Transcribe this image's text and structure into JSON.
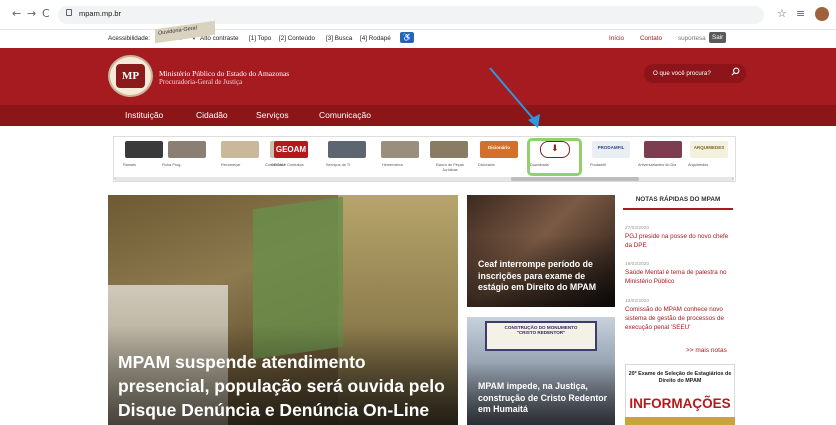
{
  "browser": {
    "back": "←",
    "forward": "→",
    "reload": "C",
    "url": "mpam.mp.br"
  },
  "accessibility_bar": {
    "label": "Acessibilidade:",
    "font_up": "A+",
    "font_normal": "A",
    "font_down": "A-",
    "contrast_symbol": "◖",
    "contrast": "Alto contraste",
    "top": "[1] Topo",
    "content": "[2] Conteúdo",
    "search": "[3] Busca",
    "footer": "[4] Rodapé",
    "badge": "♿",
    "home": "Início",
    "contact": "Contato",
    "support": "suportesa",
    "logout": "Sair"
  },
  "header": {
    "logo_text": "MP",
    "org_title": "Ministério Público do Estado do Amazonas",
    "org_subtitle": "Procuradoria-Geral de Justiça",
    "search_placeholder": "O que você procura?"
  },
  "nav": {
    "items": [
      "Instituição",
      "Cidadão",
      "Serviços",
      "Comunicação"
    ]
  },
  "shortcuts": [
    {
      "label": "Ramais",
      "color": "#3a3a3a"
    },
    {
      "label": "Ficha Prog.",
      "color": "#8a7f72"
    },
    {
      "label": "Recomeçar",
      "color": "#c9b99a"
    },
    {
      "label": "Convênios e Contratos",
      "color": "#c9c2b0",
      "tile_text": "Convênios"
    },
    {
      "label": "GEOAM",
      "color": "#b3191d",
      "tile_text": "GEOAM"
    },
    {
      "label": "Serviços de TI",
      "color": "#5d6670"
    },
    {
      "label": "Hemeroteca",
      "color": "#9a8f7c"
    },
    {
      "label": "Banco de Peças Jurídicas",
      "color": "#8a7b64"
    },
    {
      "label": "Dicionário",
      "color": "#d4702a",
      "tile_text": "Dicionário"
    },
    {
      "label": "Downloads",
      "color": "#ffffff"
    },
    {
      "label": "Prodamfil",
      "color": "#e9eef5",
      "tile_text": "PRODAMFIL"
    },
    {
      "label": "Aniversariantes do Dia",
      "color": "#7b3d4f"
    },
    {
      "label": "Arquimedes",
      "color": "#f3f0de",
      "tile_text": "ARQUIMEDES"
    }
  ],
  "features": {
    "hero_sign": "Ouvidoria-Geral",
    "hero_title": "MPAM suspende atendimento presencial, população será ouvida pelo Disque Denúncia e Denúncia On-Line",
    "card1_title": "Ceaf interrompe período de inscrições para exame de estágio em Direito do MPAM",
    "card2_board": "CONSTRUÇÃO DO MONUMENTO \"CRISTO REDENTOR\"",
    "card2_title": "MPAM impede, na Justiça, construção de Cristo Redentor em Humaitá"
  },
  "notes": {
    "title": "NOTAS RÁPIDAS DO MPAM",
    "items": [
      {
        "date": "27/02/2020",
        "text": "PGJ preside na posse do novo chefe da DPE"
      },
      {
        "date": "19/02/2020",
        "text": "Saúde Mental é tema de palestra no Ministério Público"
      },
      {
        "date": "13/02/2020",
        "text": "Comissão do MPAM conhece novo sistema de gestão de processos de execução penal 'SEEU'"
      }
    ],
    "more": ">> mais notas"
  },
  "promo": {
    "headline": "20º Exame de Seleção de Estagiários de Direito do MPAM",
    "big": "INFORMAÇÕES"
  },
  "colors": {
    "brand_red": "#a51b1f",
    "nav_red": "#8c1518",
    "highlight_green": "#8fd16a",
    "arrow_blue": "#2f97e0"
  }
}
